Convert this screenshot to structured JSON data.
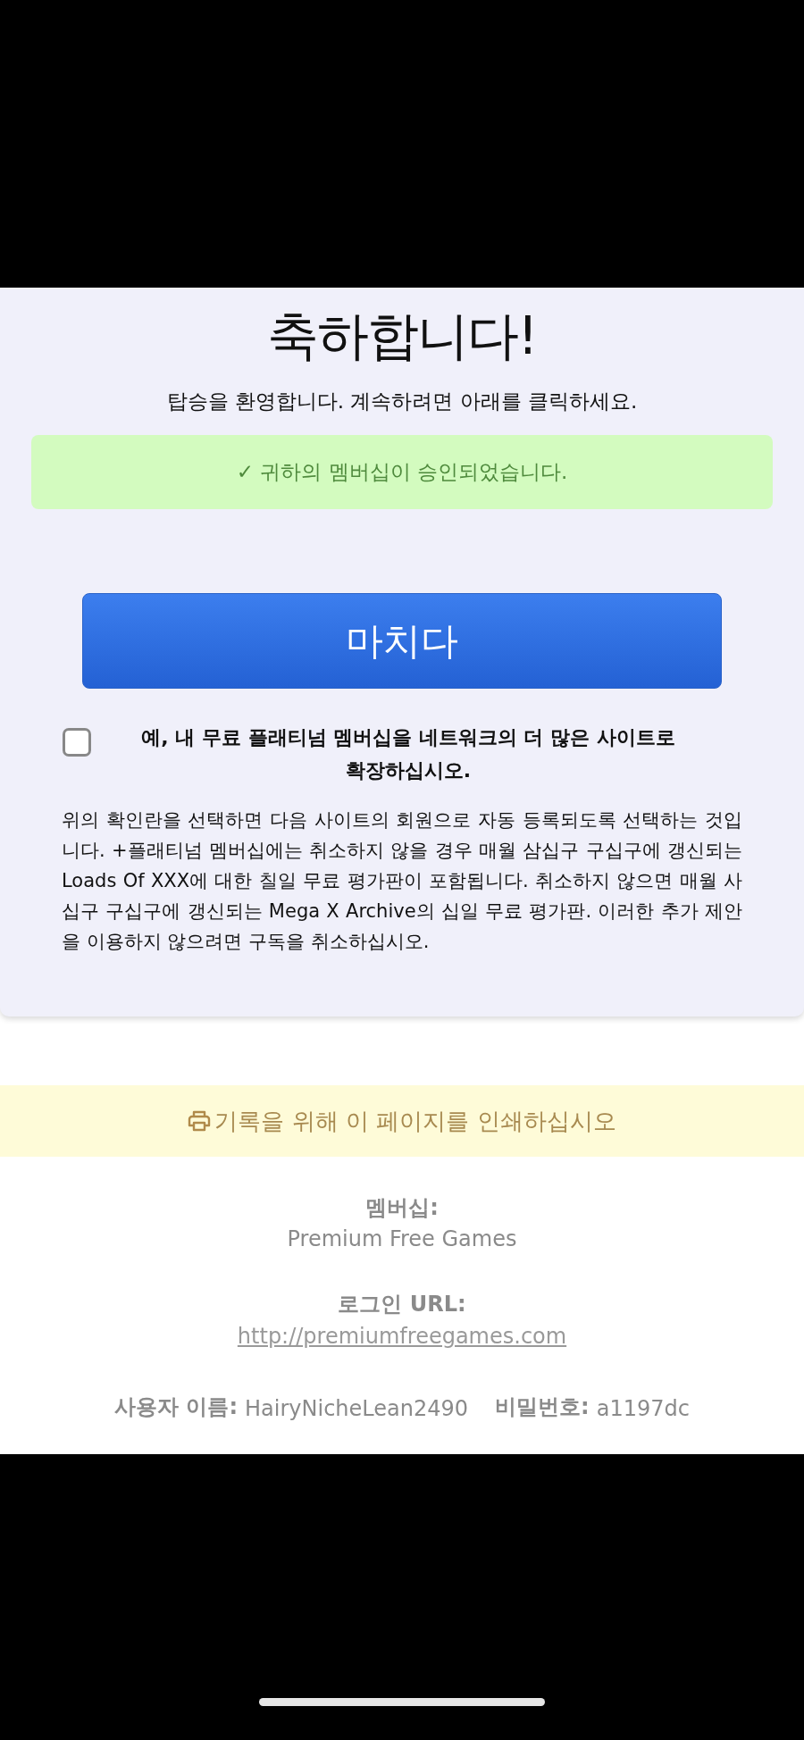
{
  "title": "축하합니다!",
  "subtitle": "탑승을 환영합니다. 계속하려면 아래를 클릭하세요.",
  "notice": "✓ 귀하의 멤버십이 승인되었습니다.",
  "finish_button": "마치다",
  "upsell": {
    "checked": false,
    "label": "예, 내 무료 플래티넘 멤버십을 네트워크의 더 많은 사이트로 확장하십시오.",
    "description": "위의 확인란을 선택하면 다음 사이트의 회원으로 자동 등록되도록 선택하는 것입니다. +플래티넘 멤버십에는 취소하지 않을 경우 매월 삼십구 구십구에 갱신되는 Loads Of XXX에 대한 칠일 무료 평가판이 포함됩니다. 취소하지 않으면 매월 사십구 구십구에 갱신되는 Mega X Archive의 십일 무료 평가판. 이러한 추가 제안을 이용하지 않으려면 구독을 취소하십시오."
  },
  "print_banner": "기록을 위해 이 페이지를 인쇄하십시오",
  "membership": {
    "label": "멤버십:",
    "value": "Premium Free Games"
  },
  "login_url": {
    "label": "로그인 URL:",
    "url": "http://premiumfreegames.com"
  },
  "credentials": [
    {
      "label": "사용자 이름:",
      "value": "HairyNicheLean2490"
    },
    {
      "label": "비밀번호:",
      "value": "a1197dc"
    }
  ]
}
